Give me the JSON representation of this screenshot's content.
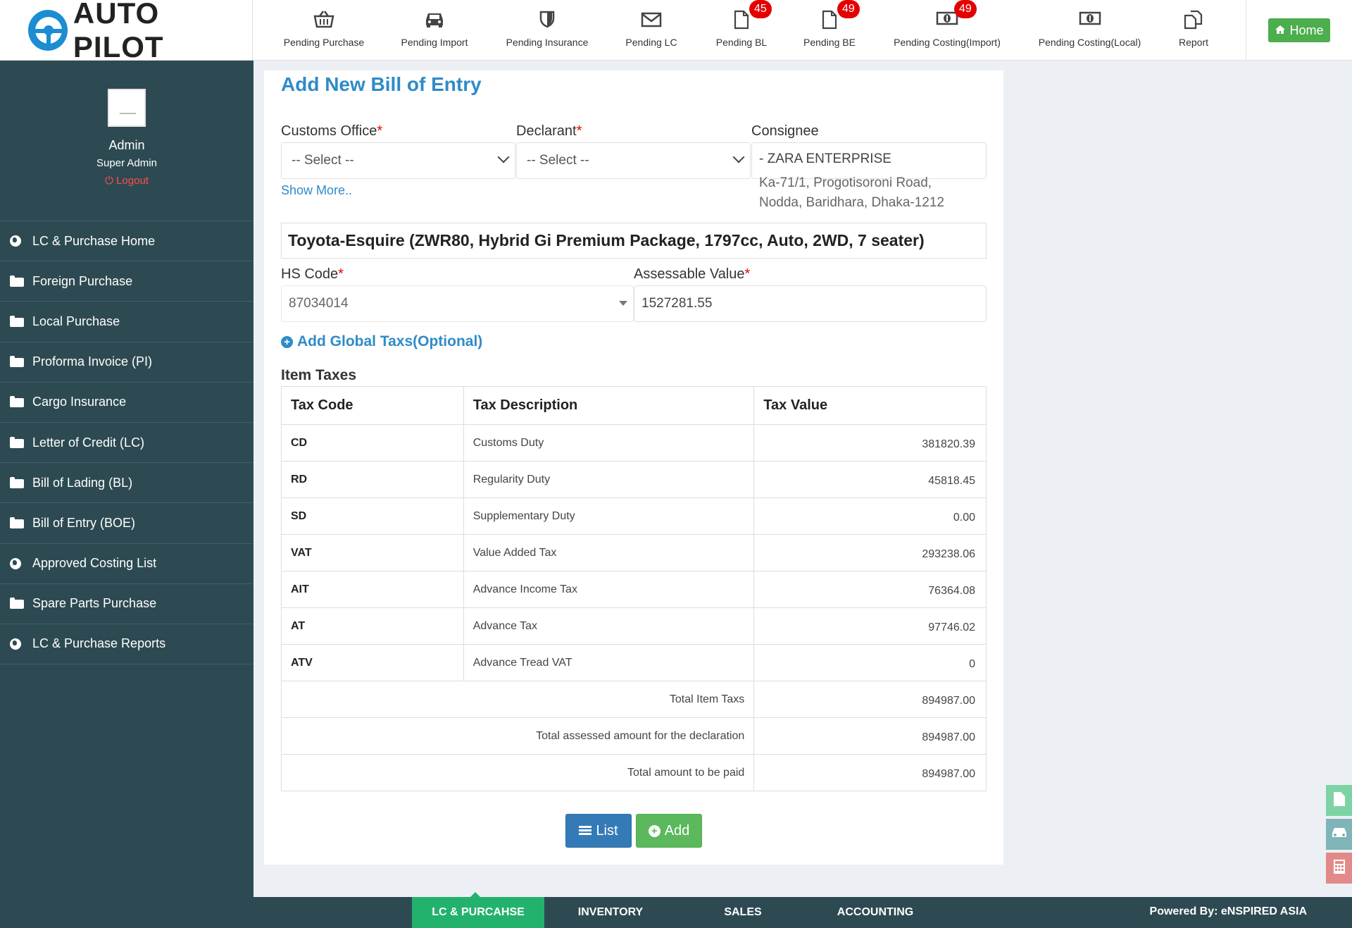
{
  "app": {
    "name": "AUTO PILOT"
  },
  "topnav": {
    "items": [
      {
        "label": "Pending Purchase",
        "badge": ""
      },
      {
        "label": "Pending Import",
        "badge": ""
      },
      {
        "label": "Pending Insurance",
        "badge": ""
      },
      {
        "label": "Pending LC",
        "badge": ""
      },
      {
        "label": "Pending BL",
        "badge": "45"
      },
      {
        "label": "Pending BE",
        "badge": "49"
      },
      {
        "label": "Pending Costing(Import)",
        "badge": "49"
      },
      {
        "label": "Pending Costing(Local)",
        "badge": ""
      },
      {
        "label": "Report",
        "badge": ""
      }
    ],
    "home_label": "Home"
  },
  "profile": {
    "name": "Admin",
    "role": "Super Admin",
    "logout": "Logout"
  },
  "sidebar": {
    "items": [
      {
        "label": "LC & Purchase Home",
        "icon": "globe-icon"
      },
      {
        "label": "Foreign Purchase",
        "icon": "folder-icon"
      },
      {
        "label": "Local Purchase",
        "icon": "folder-icon"
      },
      {
        "label": "Proforma Invoice (PI)",
        "icon": "folder-icon"
      },
      {
        "label": "Cargo Insurance",
        "icon": "folder-icon"
      },
      {
        "label": "Letter of Credit (LC)",
        "icon": "folder-icon"
      },
      {
        "label": "Bill of Lading (BL)",
        "icon": "folder-icon"
      },
      {
        "label": "Bill of Entry (BOE)",
        "icon": "folder-icon"
      },
      {
        "label": "Approved Costing List",
        "icon": "globe-icon"
      },
      {
        "label": "Spare Parts Purchase",
        "icon": "folder-icon"
      },
      {
        "label": "LC & Purchase Reports",
        "icon": "globe-icon"
      }
    ]
  },
  "form": {
    "title": "Add New Bill of Entry",
    "customs_office": {
      "label": "Customs Office",
      "value": "-- Select --"
    },
    "declarant": {
      "label": "Declarant",
      "value": "-- Select --"
    },
    "consignee": {
      "label": "Consignee",
      "value": "- ZARA ENTERPRISE",
      "address_line1": "Ka-71/1, Progotisoroni Road,",
      "address_line2": "Nodda, Baridhara, Dhaka-1212"
    },
    "show_more": "Show More..",
    "vehicle": "Toyota-Esquire (ZWR80, Hybrid Gi Premium Package, 1797cc, Auto, 2WD, 7 seater)",
    "hs_code": {
      "label": "HS Code",
      "value": "87034014"
    },
    "assessable_value": {
      "label": "Assessable Value",
      "value": "1527281.55"
    },
    "add_global_taxes": "Add Global Taxs(Optional)",
    "item_taxes_heading": "Item Taxes"
  },
  "tax_table": {
    "headers": [
      "Tax Code",
      "Tax Description",
      "Tax Value"
    ],
    "rows": [
      {
        "code": "CD",
        "desc": "Customs Duty",
        "value": "381820.39"
      },
      {
        "code": "RD",
        "desc": "Regularity Duty",
        "value": "45818.45"
      },
      {
        "code": "SD",
        "desc": "Supplementary Duty",
        "value": "0.00"
      },
      {
        "code": "VAT",
        "desc": "Value Added Tax",
        "value": "293238.06"
      },
      {
        "code": "AIT",
        "desc": "Advance Income Tax",
        "value": "76364.08"
      },
      {
        "code": "AT",
        "desc": "Advance Tax",
        "value": "97746.02"
      },
      {
        "code": "ATV",
        "desc": "Advance Tread VAT",
        "value": "0"
      }
    ],
    "totals": [
      {
        "label": "Total Item Taxs",
        "value": "894987.00"
      },
      {
        "label": "Total assessed amount for the declaration",
        "value": "894987.00"
      },
      {
        "label": "Total amount to be paid",
        "value": "894987.00"
      }
    ]
  },
  "buttons": {
    "list": "List",
    "add": "Add"
  },
  "bottom_tabs": [
    "LC & PURCAHSE",
    "INVENTORY",
    "SALES",
    "ACCOUNTING"
  ],
  "powered_by": "Powered By: eNSPIRED ASIA",
  "colors": {
    "accent": "#2e8bc9",
    "sidebar": "#2d4a52",
    "success": "#5cb85c",
    "primary": "#337ab7",
    "badge": "#e40000"
  }
}
